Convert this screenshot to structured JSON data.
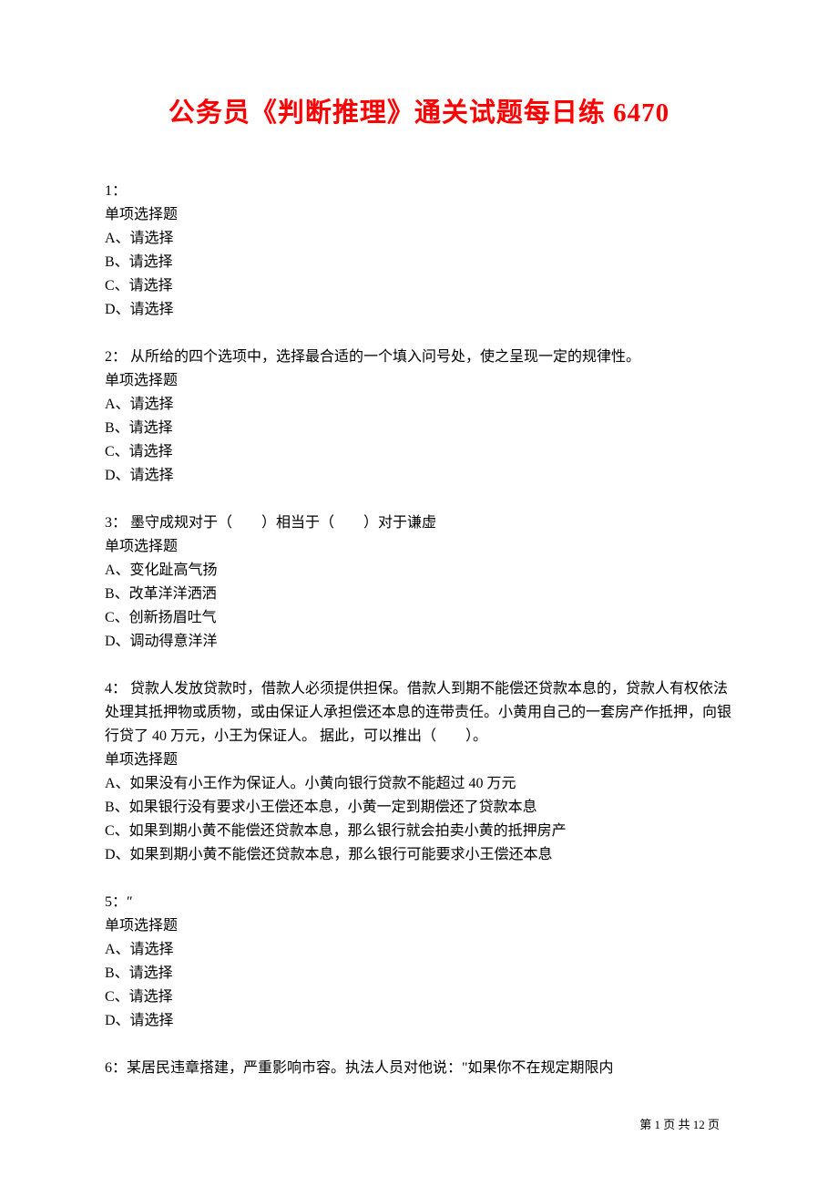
{
  "title": "公务员《判断推理》通关试题每日练 6470",
  "questions": [
    {
      "number": "1：",
      "stem": "",
      "type": "单项选择题",
      "options": [
        "A、请选择",
        "B、请选择",
        "C、请选择",
        "D、请选择"
      ]
    },
    {
      "number": "2：",
      "stem": " 从所给的四个选项中，选择最合适的一个填入问号处，使之呈现一定的规律性。",
      "type": "单项选择题",
      "options": [
        "A、请选择",
        "B、请选择",
        "C、请选择",
        "D、请选择"
      ]
    },
    {
      "number": "3：",
      "stem": " 墨守成规对于（　　）相当于（　　）对于谦虚",
      "type": "单项选择题",
      "options": [
        "A、变化趾高气扬",
        "B、改革洋洋洒洒",
        "C、创新扬眉吐气",
        "D、调动得意洋洋"
      ]
    },
    {
      "number": "4：",
      "stem": " 贷款人发放贷款时，借款人必须提供担保。借款人到期不能偿还贷款本息的，贷款人有权依法处理其抵押物或质物，或由保证人承担偿还本息的连带责任。小黄用自己的一套房产作抵押，向银行贷了 40 万元，小王为保证人。 据此，可以推出（　　）。",
      "type": "单项选择题",
      "options": [
        "A、如果没有小王作为保证人。小黄向银行贷款不能超过 40 万元",
        "B、如果银行没有要求小王偿还本息，小黄一定到期偿还了贷款本息",
        "C、如果到期小黄不能偿还贷款本息，那么银行就会拍卖小黄的抵押房产",
        "D、如果到期小黄不能偿还贷款本息，那么银行可能要求小王偿还本息"
      ]
    },
    {
      "number": "5：",
      "stem": "″",
      "type": "单项选择题",
      "options": [
        "A、请选择",
        "B、请选择",
        "C、请选择",
        "D、请选择"
      ]
    },
    {
      "number": "6：",
      "stem": "某居民违章搭建，严重影响市容。执法人员对他说：\"如果你不在规定期限内",
      "type": "",
      "options": []
    }
  ],
  "footer": "第 1 页 共 12 页"
}
